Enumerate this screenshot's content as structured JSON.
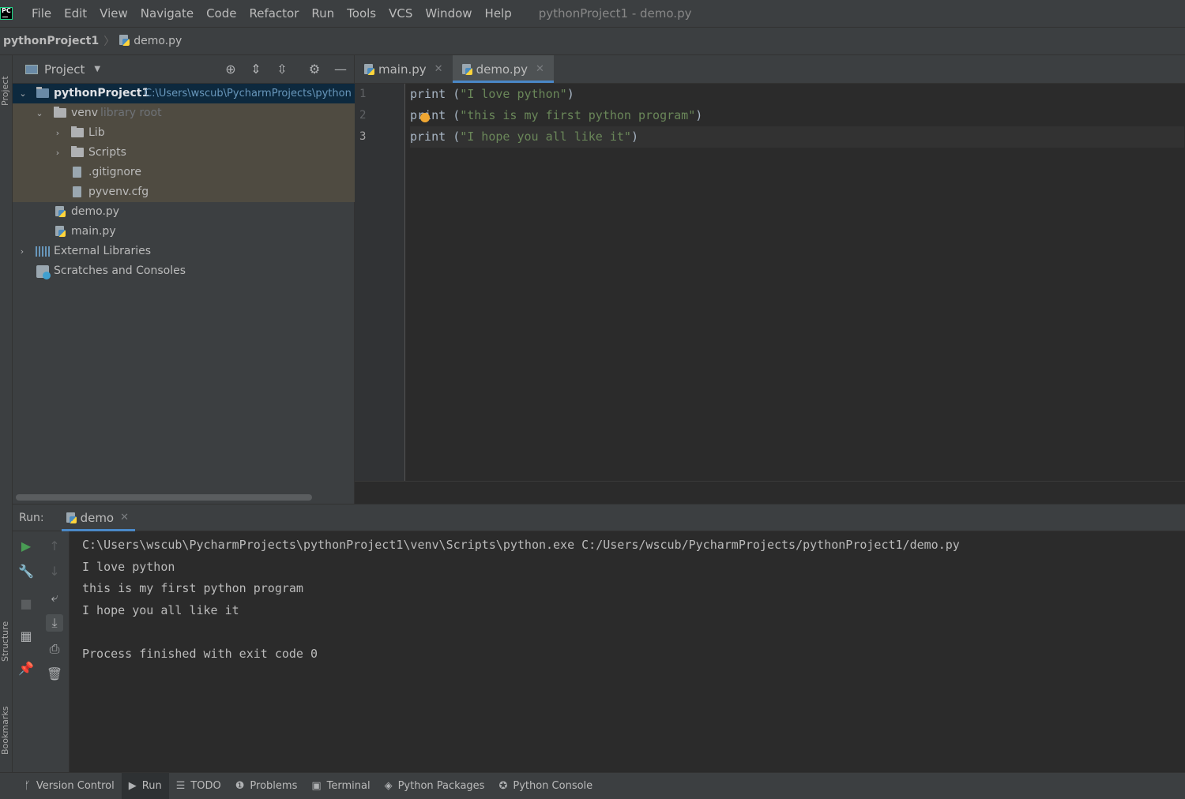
{
  "menubar": {
    "items": [
      "File",
      "Edit",
      "View",
      "Navigate",
      "Code",
      "Refactor",
      "Run",
      "Tools",
      "VCS",
      "Window",
      "Help"
    ],
    "window_title": "pythonProject1 - demo.py"
  },
  "breadcrumb": {
    "project": "pythonProject1",
    "file": "demo.py"
  },
  "left_strip": {
    "project": "Project",
    "structure": "Structure",
    "bookmarks": "Bookmarks"
  },
  "project_panel": {
    "title": "Project",
    "tree": {
      "root": {
        "label": "pythonProject1",
        "path": "C:\\Users\\wscub\\PycharmProjects\\python"
      },
      "venv": {
        "label": "venv",
        "note": "library root"
      },
      "lib": "Lib",
      "scripts": "Scripts",
      "gitignore": ".gitignore",
      "pyvenv": "pyvenv.cfg",
      "demo": "demo.py",
      "main": "main.py",
      "external": "External Libraries",
      "scratches": "Scratches and Consoles"
    }
  },
  "editor": {
    "tabs": [
      {
        "label": "main.py",
        "active": false
      },
      {
        "label": "demo.py",
        "active": true
      }
    ],
    "line_numbers": [
      "1",
      "2",
      "3"
    ],
    "lines": [
      {
        "fn": "print",
        "args": "\"I love python\""
      },
      {
        "fn": "print",
        "args": "\"this is my first python program\""
      },
      {
        "fn": "print",
        "args": "\"I hope you all like it\""
      }
    ]
  },
  "run_panel": {
    "label": "Run:",
    "tab": "demo",
    "console": [
      "C:\\Users\\wscub\\PycharmProjects\\pythonProject1\\venv\\Scripts\\python.exe C:/Users/wscub/PycharmProjects/pythonProject1/demo.py",
      "I love python",
      "this is my first python program",
      "I hope you all like it",
      "",
      "Process finished with exit code 0"
    ]
  },
  "bottom_bar": {
    "items": [
      "Version Control",
      "Run",
      "TODO",
      "Problems",
      "Terminal",
      "Python Packages",
      "Python Console"
    ]
  },
  "colors": {
    "accent": "#4a88c7",
    "string": "#6a8759",
    "bulb": "#f0a732",
    "run_green": "#499c54"
  }
}
